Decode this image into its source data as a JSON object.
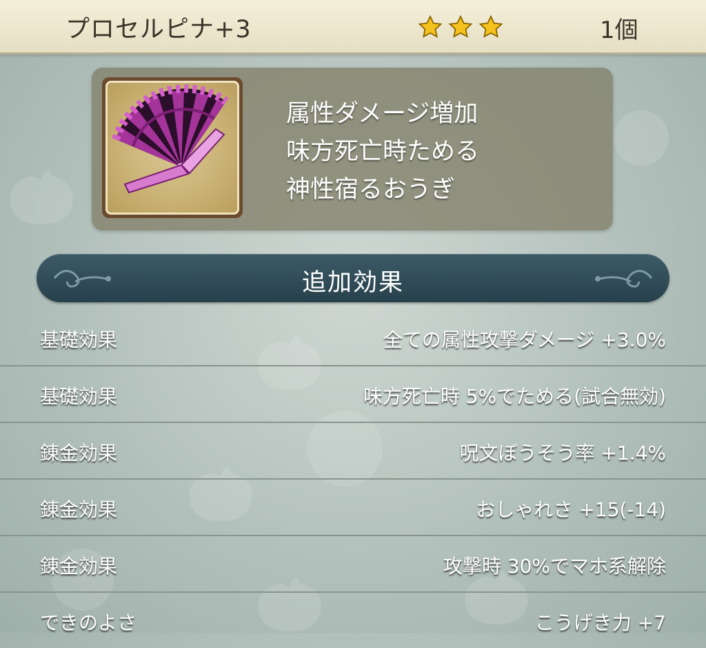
{
  "header": {
    "item_name": "プロセルピナ+3",
    "rarity_stars": 3,
    "quantity": "1個"
  },
  "item": {
    "icon": "purple-fan-icon",
    "description_lines": [
      "属性ダメージ増加",
      "味方死亡時ためる",
      "神性宿るおうぎ"
    ]
  },
  "section": {
    "title": "追加効果"
  },
  "effects": [
    {
      "label": "基礎効果",
      "value": "全ての属性攻撃ダメージ +3.0%"
    },
    {
      "label": "基礎効果",
      "value": "味方死亡時 5%でためる(試合無効)"
    },
    {
      "label": "錬金効果",
      "value": "呪文ぼうそう率 +1.4%"
    },
    {
      "label": "錬金効果",
      "value": "おしゃれさ +15(-14)"
    },
    {
      "label": "錬金効果",
      "value": "攻撃時 30%でマホ系解除"
    },
    {
      "label": "できのよさ",
      "value": "こうげき力 +7"
    }
  ],
  "colors": {
    "header_bg": "#ece6cc",
    "section_bar": "#2f4a55",
    "star": "#f4c21c",
    "fan": "#9b2d8f"
  }
}
